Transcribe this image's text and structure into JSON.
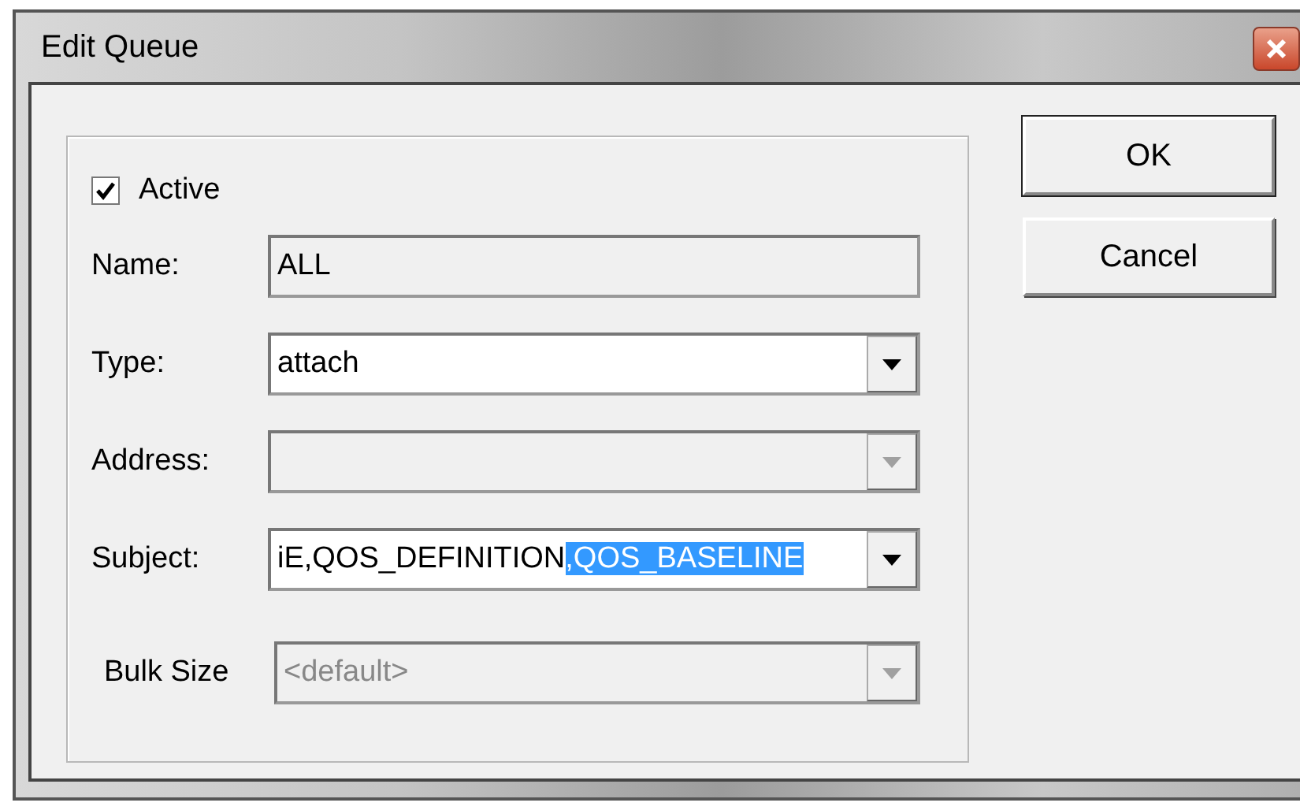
{
  "window": {
    "title": "Edit Queue"
  },
  "active": {
    "label": "Active",
    "checked": true
  },
  "fields": [
    {
      "label": "Name:",
      "kind": "text",
      "value": "ALL",
      "disabled": false,
      "readonly": true
    },
    {
      "label": "Type:",
      "kind": "combo",
      "value": "attach",
      "disabled": false,
      "readonly": false
    },
    {
      "label": "Address:",
      "kind": "combo",
      "disabled": true,
      "readonly": false
    },
    {
      "label": "Subject:",
      "kind": "combo",
      "value": "iE,QOS_DEFINITION",
      "selected_text": ",QOS_BASELINE",
      "disabled": false,
      "readonly": false
    },
    {
      "label": "Bulk Size",
      "kind": "combo",
      "value": "<default>",
      "disabled": true,
      "readonly": false
    }
  ],
  "buttons": [
    "OK",
    "Cancel"
  ]
}
